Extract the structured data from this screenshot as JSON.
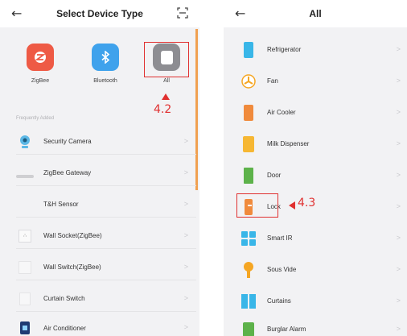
{
  "left_screen": {
    "title": "Select Device Type",
    "categories": [
      {
        "label": "ZigBee",
        "icon": "zigbee-icon",
        "color": "#ee5a45"
      },
      {
        "label": "Bluetooth",
        "icon": "bluetooth-icon",
        "color": "#3fa2ec"
      },
      {
        "label": "All",
        "icon": "all-devices-icon",
        "color": "#8d8d92"
      }
    ],
    "section_label": "Frequently Added",
    "step_label": "4.2",
    "devices": [
      {
        "label": "Security Camera",
        "icon": "security-camera-icon"
      },
      {
        "label": "ZigBee Gateway",
        "icon": "zigbee-gateway-icon"
      },
      {
        "label": "T&H Sensor",
        "icon": "th-sensor-icon"
      },
      {
        "label": "Wall Socket(ZigBee)",
        "icon": "wall-socket-icon"
      },
      {
        "label": "Wall Switch(ZigBee)",
        "icon": "wall-switch-icon"
      },
      {
        "label": "Curtain Switch",
        "icon": "curtain-switch-icon"
      },
      {
        "label": "Air Conditioner",
        "icon": "air-conditioner-icon"
      }
    ]
  },
  "right_screen": {
    "title": "All",
    "step_label": "4.3",
    "devices": [
      {
        "label": "Refrigerator",
        "icon": "refrigerator-icon"
      },
      {
        "label": "Fan",
        "icon": "fan-icon"
      },
      {
        "label": "Air Cooler",
        "icon": "air-cooler-icon"
      },
      {
        "label": "Milk Dispenser",
        "icon": "milk-dispenser-icon"
      },
      {
        "label": "Door",
        "icon": "door-icon"
      },
      {
        "label": "Lock",
        "icon": "lock-icon"
      },
      {
        "label": "Smart IR",
        "icon": "smart-ir-icon"
      },
      {
        "label": "Sous Vide",
        "icon": "sous-vide-icon"
      },
      {
        "label": "Curtains",
        "icon": "curtains-icon"
      },
      {
        "label": "Burglar Alarm",
        "icon": "burglar-alarm-icon"
      }
    ]
  },
  "colors": {
    "highlight": "#e03030",
    "accent_bar": "#f0a050"
  }
}
